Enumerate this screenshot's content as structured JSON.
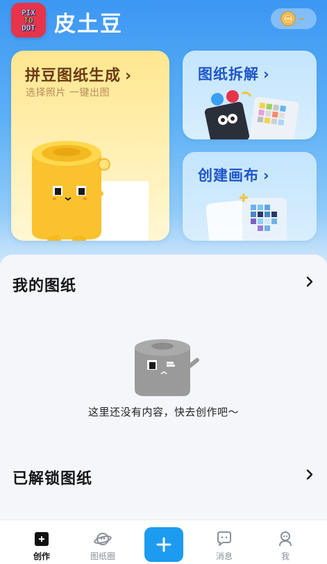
{
  "app": {
    "title": "皮土豆",
    "logo_lines": [
      "PIX",
      "TO",
      "DOT"
    ]
  },
  "header": {
    "coin_icon": "coin-icon"
  },
  "cards": {
    "main": {
      "title": "拼豆图纸生成",
      "subtitle": "选择照片 一键出图",
      "chevron": "›"
    },
    "decompose": {
      "title": "图纸拆解",
      "chevron": "›"
    },
    "canvas": {
      "title": "创建画布",
      "chevron": "›"
    }
  },
  "sections": {
    "my_patterns": {
      "title": "我的图纸",
      "empty_text": "这里还没有内容，快去创作吧～"
    },
    "unlocked_patterns": {
      "title": "已解锁图纸"
    }
  },
  "bottom_nav": {
    "items": [
      {
        "label": "创作",
        "icon": "create-icon",
        "active": true
      },
      {
        "label": "图纸圈",
        "icon": "planet-icon",
        "active": false
      },
      {
        "label": "",
        "icon": "plus-icon",
        "active": false
      },
      {
        "label": "消息",
        "icon": "message-icon",
        "active": false
      },
      {
        "label": "我",
        "icon": "profile-icon",
        "active": false
      }
    ]
  },
  "colors": {
    "primary_blue": "#1d9bf0",
    "header_gradient_top": "#3c97f3",
    "main_card_yellow": "#ffe68f",
    "side_card_blue": "#c4e5fd",
    "title_brown": "#6b3a12",
    "side_title_blue": "#1e55c8"
  }
}
